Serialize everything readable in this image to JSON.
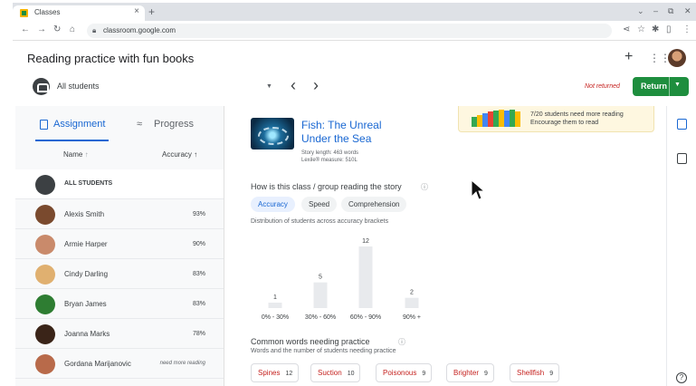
{
  "browser": {
    "tab_title": "Classes",
    "url": "classroom.google.com"
  },
  "header": {
    "title": "Reading practice with fun books",
    "students_select": "All students",
    "status": "Not returned",
    "return_label": "Return"
  },
  "left_panel": {
    "tabs": [
      {
        "label": "Assignment",
        "active": true
      },
      {
        "label": "Progress",
        "active": false
      }
    ],
    "columns": {
      "name": "Name",
      "accuracy": "Accuracy"
    },
    "all_students_label": "ALL STUDENTS",
    "students": [
      {
        "name": "Alexis Smith",
        "value": "93%",
        "avatar_color": "#7a4a2e"
      },
      {
        "name": "Armie Harper",
        "value": "90%",
        "avatar_color": "#c98a6b"
      },
      {
        "name": "Cindy Darling",
        "value": "83%",
        "avatar_color": "#e0b070"
      },
      {
        "name": "Bryan James",
        "value": "83%",
        "avatar_color": "#2e7d32"
      },
      {
        "name": "Joanna Marks",
        "value": "78%",
        "avatar_color": "#3a2418"
      },
      {
        "name": "Gordana Marijanovic",
        "value": "need more reading",
        "avatar_color": "#b86a4a"
      }
    ]
  },
  "book": {
    "title": "Fish: The Unreal Under the Sea",
    "story_length": "Story length: 463 words",
    "lexile": "Lexile® measure: 510L"
  },
  "notice": {
    "line1": "7/20 students need more reading",
    "line2": "Encourage them to read"
  },
  "insights": {
    "question": "How is this class / group reading the story",
    "chips": [
      {
        "label": "Accuracy",
        "active": true
      },
      {
        "label": "Speed",
        "active": false
      },
      {
        "label": "Comprehension",
        "active": false
      }
    ],
    "chart_desc": "Distribution of students across accuracy brackets"
  },
  "chart_data": {
    "type": "bar",
    "categories": [
      "0% - 30%",
      "30% - 60%",
      "60% - 90%",
      "90% +"
    ],
    "values": [
      1,
      5,
      12,
      2
    ],
    "ylim": [
      0,
      12
    ],
    "grid": false,
    "bar_color": "#e8eaed",
    "data_labels": true
  },
  "words": {
    "title": "Common words needing practice",
    "desc": "Words and the number of students needing practice",
    "items": [
      {
        "word": "Spines",
        "count": "12"
      },
      {
        "word": "Suction",
        "count": "10"
      },
      {
        "word": "Poisonous",
        "count": "9"
      },
      {
        "word": "Brighter",
        "count": "9"
      },
      {
        "word": "Shellfish",
        "count": "9"
      }
    ]
  },
  "colors": {
    "accent": "#1967d2",
    "return": "#1e8e3e",
    "alert": "#c5221f"
  }
}
